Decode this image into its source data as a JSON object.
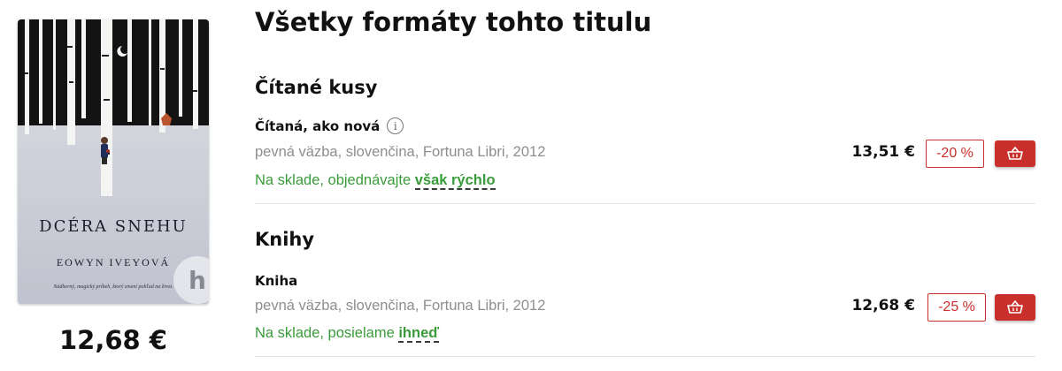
{
  "book": {
    "cover_title": "DCÉRA SNEHU",
    "cover_author": "EOWYN IVEYOVÁ",
    "cover_tagline": "Nádherný, magický príbeh, ktorý zmení pohľad na život.",
    "badge": "h",
    "price": "12,68 €"
  },
  "page": {
    "title": "Všetky formáty tohto titulu"
  },
  "sections": [
    {
      "title": "Čítané kusy",
      "item": {
        "name": "Čítaná, ako nová",
        "info_icon": "info-icon",
        "meta": "pevná väzba, slovenčina, Fortuna Libri, 2012",
        "stock_prefix": "Na sklade, objednávajte",
        "stock_emphasis": "však rýchlo",
        "price": "13,51 €",
        "discount": "-20 %",
        "cart_icon": "basket-icon"
      }
    },
    {
      "title": "Knihy",
      "item": {
        "name": "Kniha",
        "meta": "pevná väzba, slovenčina, Fortuna Libri, 2012",
        "stock_prefix": "Na sklade, posielame",
        "stock_emphasis": "ihneď",
        "price": "12,68 €",
        "discount": "-25 %",
        "cart_icon": "basket-icon"
      }
    }
  ],
  "colors": {
    "accent": "#c9302c",
    "stock_green": "#3a9b3a",
    "meta_gray": "#8e8e8e"
  }
}
